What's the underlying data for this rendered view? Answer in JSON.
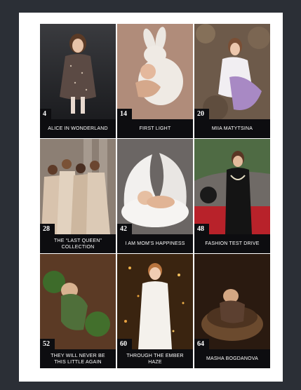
{
  "tiles": [
    {
      "page": "4",
      "title": "ALICE IN WONDERLAND"
    },
    {
      "page": "14",
      "title": "FIRST LIGHT"
    },
    {
      "page": "20",
      "title": "MIIA MATYTSINA"
    },
    {
      "page": "28",
      "title": "THE “LAST QUEEN” COLLECTION"
    },
    {
      "page": "42",
      "title": "I AM MOM’S HAPPINESS"
    },
    {
      "page": "48",
      "title": "FASHION TEST DRIVE"
    },
    {
      "page": "52",
      "title": "THEY WILL NEVER BE THIS LITTLE AGAIN"
    },
    {
      "page": "60",
      "title": "THROUGH THE EMBER HAZE"
    },
    {
      "page": "64",
      "title": "MASHA BOGDANOVA"
    }
  ]
}
